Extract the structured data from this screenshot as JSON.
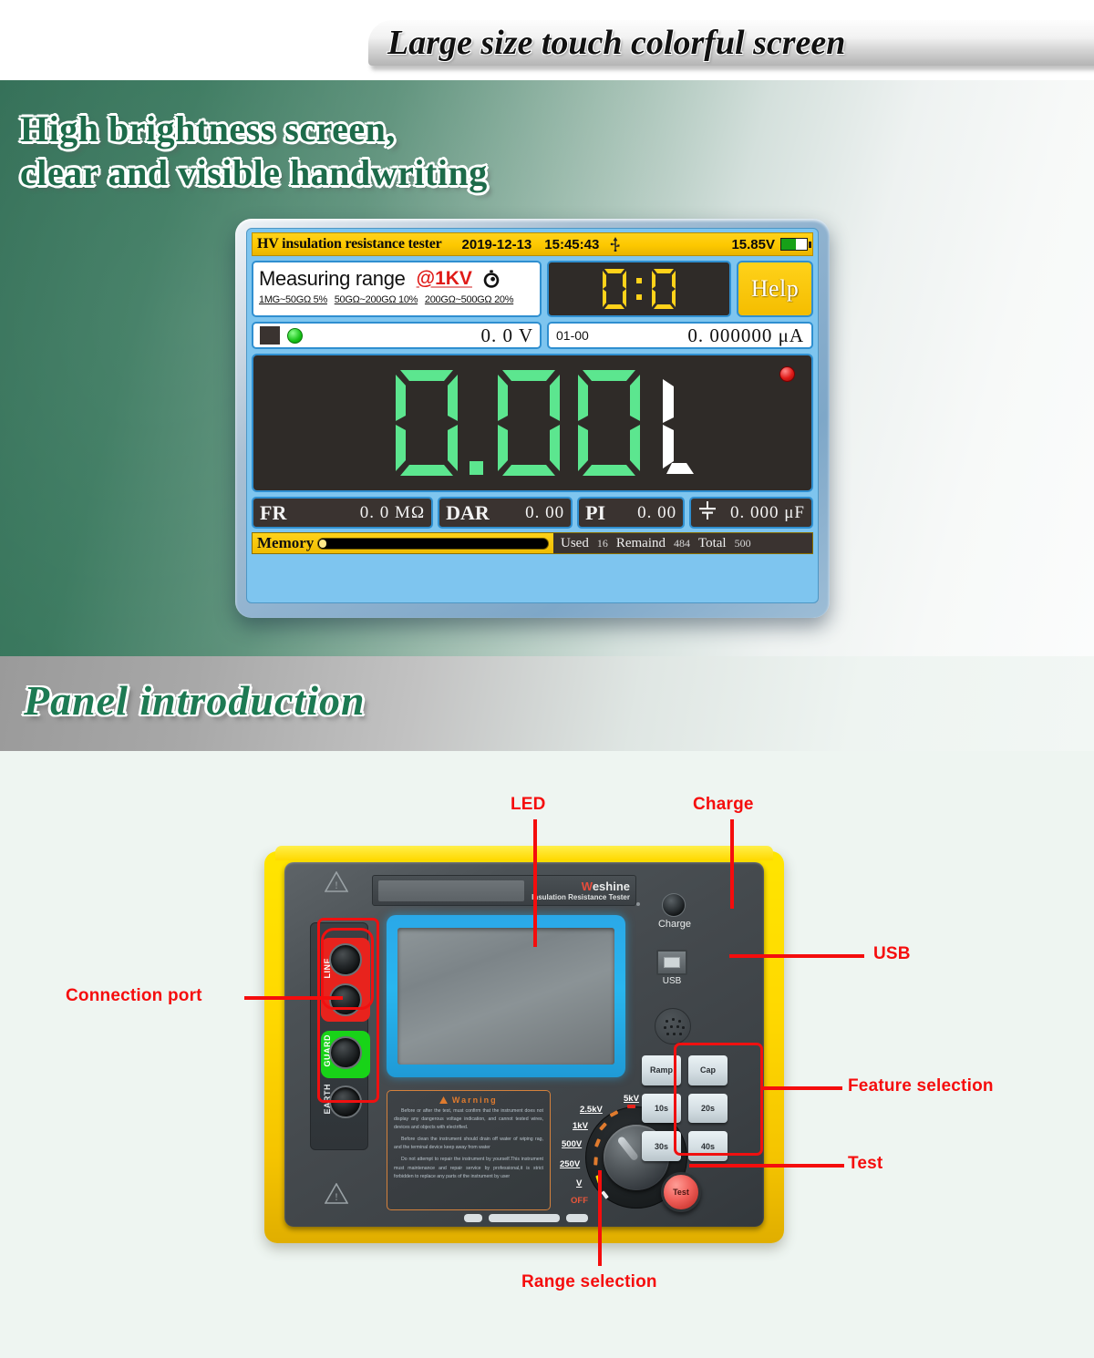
{
  "banner": {
    "headline": "Large size touch colorful screen"
  },
  "hero": {
    "title": "High brightness screen,\nclear and visible handwriting"
  },
  "band": {
    "title": "Panel introduction"
  },
  "lcd": {
    "topbar": {
      "title": "HV insulation resistance tester",
      "date": "2019-12-13",
      "time": "15:45:43",
      "usb_icon": "usb-icon",
      "voltage": "15.85V",
      "battery_icon": "battery-icon",
      "battery_level": 58
    },
    "range": {
      "label": "Measuring range",
      "value": "@1KV",
      "clock_icon": "stopwatch-icon",
      "accuracy": [
        "1MG~50GΩ 5%",
        "50GΩ~200GΩ 10%",
        "200GΩ~500GΩ 20%"
      ]
    },
    "timer": {
      "value": "0:0"
    },
    "help_button": "Help",
    "voltage_row": {
      "indicator_icon": "status-led-icon",
      "value": "0. 0 V"
    },
    "current_row": {
      "record_id": "01-00",
      "value": "0. 000000 μA"
    },
    "main": {
      "reading": "0.00",
      "unit": "L",
      "alarm_icon": "alarm-dot-icon"
    },
    "measures": [
      {
        "key": "FR",
        "value": "0. 0 MΩ"
      },
      {
        "key": "DAR",
        "value": "0. 00"
      },
      {
        "key": "PI",
        "value": "0. 00"
      },
      {
        "key": "capacitance-icon",
        "value": "0. 000 μF"
      }
    ],
    "memory": {
      "label": "Memory",
      "used_label": "Used",
      "used": "16",
      "remain_label": "Remaind",
      "remain": "484",
      "total_label": "Total",
      "total": "500"
    }
  },
  "device": {
    "brand": "Weshine",
    "brand_first_letter": "W",
    "brand_rest": "eshine",
    "model_sub": "Insulation Resistance Tester",
    "charge_label": "Charge",
    "usb_label": "USB",
    "terminals": [
      {
        "name": "LINE",
        "color": "#e8231d"
      },
      {
        "name": "GUARD",
        "color": "#18d318"
      },
      {
        "name": "EARTH",
        "color": "#2f3438"
      }
    ],
    "warning": {
      "title": "Warning",
      "icon": "warning-triangle-icon",
      "paragraphs": [
        "Before or after the test, must confirm that the instrument does not display any dangerous voltage indication, and cannot tested wires, devices and objects with electrified.",
        "Before clean the instrument should drain off water of wiping rag, and the terminal device keep away from water",
        "Do not attempt to repair the instrument by yourself.This instrument must maintenance and repair service by professional,it is strict forbidden to replace any parts of the instrument by user"
      ]
    },
    "dial": {
      "positions": [
        "5kV",
        "2.5kV",
        "1kV",
        "500V",
        "250V",
        "V",
        "OFF"
      ]
    },
    "buttons": [
      "Ramp",
      "Cap",
      "10s",
      "20s",
      "30s",
      "40s"
    ],
    "test_button": "Test"
  },
  "callouts": {
    "led": "LED",
    "charge": "Charge",
    "usb": "USB",
    "connection_port": "Connection port",
    "feature_selection": "Feature selection",
    "test": "Test",
    "range_selection": "Range selection"
  },
  "colors": {
    "accent_red": "#f50d0d",
    "brand_green": "#1d7a53",
    "lcd_yellow": "#ffd21a",
    "lcd_blue": "#2f8fd0",
    "segment_green": "#5ce68f",
    "case_yellow": "#ffd900"
  }
}
